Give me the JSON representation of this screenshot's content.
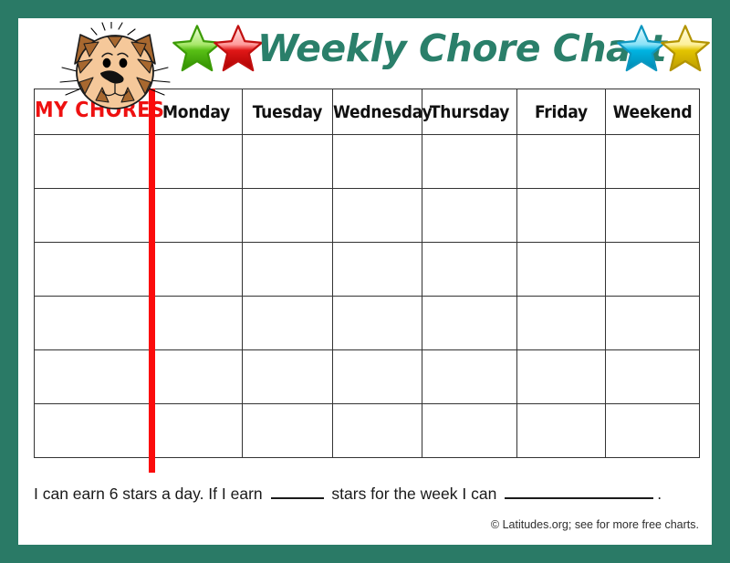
{
  "theme": {
    "frame_color": "#2a7a66",
    "title_color": "#2a7f6a",
    "chores_label_color": "#ee1111",
    "divider_color": "#fb0c0c",
    "grid_color": "#333333"
  },
  "header": {
    "title": "Weekly Chore Chart",
    "mascot": "cat-face-icon",
    "stars": [
      {
        "name": "star-green-icon",
        "color": "#5fbf19",
        "highlight": "#e8ffd0"
      },
      {
        "name": "star-red-icon",
        "color": "#cc0000",
        "highlight": "#ffdede"
      },
      {
        "name": "star-cyan-icon",
        "color": "#00a7d4",
        "highlight": "#d9f7ff"
      },
      {
        "name": "star-yellow-icon",
        "color": "#d9b300",
        "highlight": "#fffbd0"
      }
    ]
  },
  "table": {
    "chores_column_header": "MY CHORES",
    "day_headers": [
      "Monday",
      "Tuesday",
      "Wednesday",
      "Thursday",
      "Friday",
      "Weekend"
    ],
    "body_row_count": 6,
    "rows": [
      {
        "chore": "",
        "days": [
          "",
          "",
          "",
          "",
          "",
          ""
        ]
      },
      {
        "chore": "",
        "days": [
          "",
          "",
          "",
          "",
          "",
          ""
        ]
      },
      {
        "chore": "",
        "days": [
          "",
          "",
          "",
          "",
          "",
          ""
        ]
      },
      {
        "chore": "",
        "days": [
          "",
          "",
          "",
          "",
          "",
          ""
        ]
      },
      {
        "chore": "",
        "days": [
          "",
          "",
          "",
          "",
          "",
          ""
        ]
      },
      {
        "chore": "",
        "days": [
          "",
          "",
          "",
          "",
          "",
          ""
        ]
      }
    ]
  },
  "footer": {
    "sentence_part_1": "I can earn 6 stars a day. If I earn",
    "sentence_part_2": "stars for the week I can",
    "sentence_part_3": ".",
    "stars_per_day": 6,
    "credit": "© Latitudes.org; see for more free charts."
  }
}
